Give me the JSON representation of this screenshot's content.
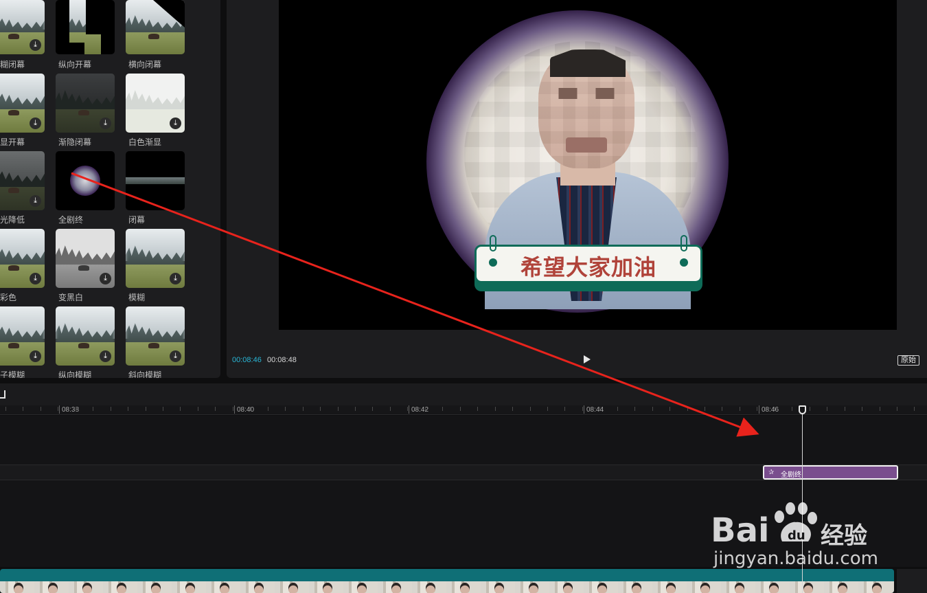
{
  "effects": {
    "items": [
      {
        "label": "糊闭幕"
      },
      {
        "label": "纵向开幕"
      },
      {
        "label": "横向闭幕"
      },
      {
        "label": "显开幕"
      },
      {
        "label": "渐隐闭幕"
      },
      {
        "label": "白色渐显"
      },
      {
        "label": "光降低"
      },
      {
        "label": "全剧终"
      },
      {
        "label": "闭幕"
      },
      {
        "label": "彩色"
      },
      {
        "label": "变黑白"
      },
      {
        "label": "模糊"
      },
      {
        "label": "子模糊"
      },
      {
        "label": "纵向模糊"
      },
      {
        "label": "斜向模糊"
      }
    ],
    "download_icon": "⤓"
  },
  "preview": {
    "banner_text": "希望大家加油",
    "current_time": "00:08:46",
    "total_time": "00:08:48",
    "original_label": "原始"
  },
  "timeline": {
    "ruler_labels": [
      "08:38",
      "08:40",
      "08:42",
      "08:44",
      "08:46"
    ],
    "effect_clip_label": "全剧终",
    "effect_clip_icon": "✰"
  },
  "watermark": {
    "brand_left": "Bai",
    "brand_mid": "du",
    "brand_right": "经验",
    "url": "jingyan.baidu.com"
  },
  "colors": {
    "accent_time": "#29b6d6",
    "effect_clip": "#7a4e8e",
    "annotation_arrow": "#e8231c",
    "banner_green": "#0e6b58",
    "banner_text": "#b0433a"
  }
}
